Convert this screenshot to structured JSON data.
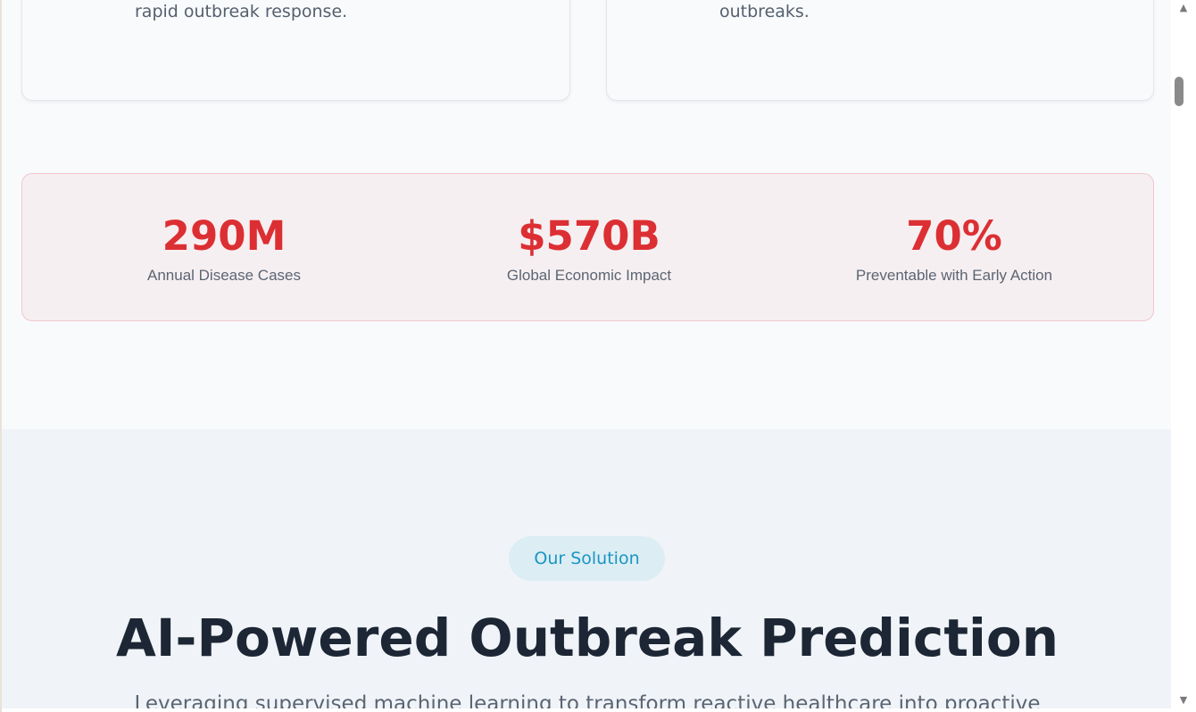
{
  "problem_cards": [
    {
      "text": "bear the heaviest burden, lacking resources for rapid outbreak response."
    },
    {
      "text": "leveraged effectively to predict and prevent outbreaks."
    }
  ],
  "stats": [
    {
      "value": "290M",
      "label": "Annual Disease Cases"
    },
    {
      "value": "$570B",
      "label": "Global Economic Impact"
    },
    {
      "value": "70%",
      "label": "Preventable with Early Action"
    }
  ],
  "solution": {
    "badge": "Our Solution",
    "headline": "AI-Powered Outbreak Prediction",
    "subtext": "Leveraging supervised machine learning to transform reactive healthcare into proactive"
  },
  "colors": {
    "stat_accent": "#dc2f33",
    "badge_text": "#1a96c1",
    "badge_bg": "#dcedf4",
    "headline": "#1d2634"
  },
  "icons": {
    "scroll_up": "▲",
    "scroll_down": "▼"
  }
}
